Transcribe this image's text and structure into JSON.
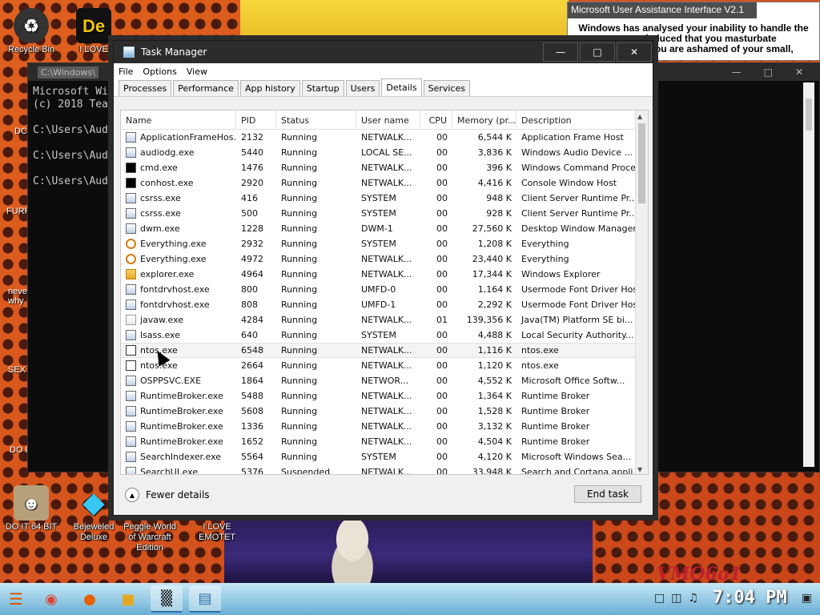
{
  "desktop": {
    "icons": [
      {
        "label": "Recycle Bin"
      },
      {
        "label": "I LOVE"
      },
      {
        "label": "DO IT 64 BIT"
      },
      {
        "label": "Bejeweled Deluxe"
      },
      {
        "label": "Peggle World of Warcraft Edition"
      },
      {
        "label": "I LOVE EMOTET"
      }
    ],
    "edge_labels": [
      "DC",
      "FURF",
      "neve why",
      "SEX",
      "DO I",
      "DO I"
    ],
    "bottom_art_text": "VMO6o1"
  },
  "console": {
    "title": "C:\\Windows\\",
    "lines": [
      "Microsoft Wi",
      "(c) 2018 Tea",
      "",
      "C:\\Users\\Audi",
      "",
      "C:\\Users\\Audi",
      "",
      "C:\\Users\\Audi"
    ]
  },
  "assist": {
    "title": "Microsoft User Assistance Interface V2.1",
    "lines": [
      "Windows has analysed your inability to handle the",
      "deduced that you masturbate",
      "e you are ashamed of your small,"
    ]
  },
  "task_manager": {
    "title": "Task Manager",
    "menu": [
      "File",
      "Options",
      "View"
    ],
    "tabs": [
      "Processes",
      "Performance",
      "App history",
      "Startup",
      "Users",
      "Details",
      "Services"
    ],
    "active_tab": "Details",
    "columns": [
      "Name",
      "PID",
      "Status",
      "User name",
      "CPU",
      "Memory (pr...",
      "Description"
    ],
    "rows": [
      {
        "icon": "app",
        "name": "ApplicationFrameHos...",
        "pid": "2132",
        "status": "Running",
        "user": "NETWALK...",
        "cpu": "00",
        "mem": "6,544 K",
        "desc": "Application Frame Host"
      },
      {
        "icon": "app",
        "name": "audiodg.exe",
        "pid": "5440",
        "status": "Running",
        "user": "LOCAL SE...",
        "cpu": "00",
        "mem": "3,836 K",
        "desc": "Windows Audio Device ..."
      },
      {
        "icon": "cmd",
        "name": "cmd.exe",
        "pid": "1476",
        "status": "Running",
        "user": "NETWALK...",
        "cpu": "00",
        "mem": "396 K",
        "desc": "Windows Command Proce..."
      },
      {
        "icon": "cmd",
        "name": "conhost.exe",
        "pid": "2920",
        "status": "Running",
        "user": "NETWALK...",
        "cpu": "00",
        "mem": "4,416 K",
        "desc": "Console Window Host"
      },
      {
        "icon": "app",
        "name": "csrss.exe",
        "pid": "416",
        "status": "Running",
        "user": "SYSTEM",
        "cpu": "00",
        "mem": "948 K",
        "desc": "Client Server Runtime Pr..."
      },
      {
        "icon": "app",
        "name": "csrss.exe",
        "pid": "500",
        "status": "Running",
        "user": "SYSTEM",
        "cpu": "00",
        "mem": "928 K",
        "desc": "Client Server Runtime Pr..."
      },
      {
        "icon": "app",
        "name": "dwm.exe",
        "pid": "1228",
        "status": "Running",
        "user": "DWM-1",
        "cpu": "00",
        "mem": "27,560 K",
        "desc": "Desktop Window Manager"
      },
      {
        "icon": "search",
        "name": "Everything.exe",
        "pid": "2932",
        "status": "Running",
        "user": "SYSTEM",
        "cpu": "00",
        "mem": "1,208 K",
        "desc": "Everything"
      },
      {
        "icon": "search",
        "name": "Everything.exe",
        "pid": "4972",
        "status": "Running",
        "user": "NETWALK...",
        "cpu": "00",
        "mem": "23,440 K",
        "desc": "Everything"
      },
      {
        "icon": "folder",
        "name": "explorer.exe",
        "pid": "4964",
        "status": "Running",
        "user": "NETWALK...",
        "cpu": "00",
        "mem": "17,344 K",
        "desc": "Windows Explorer"
      },
      {
        "icon": "app",
        "name": "fontdrvhost.exe",
        "pid": "800",
        "status": "Running",
        "user": "UMFD-0",
        "cpu": "00",
        "mem": "1,164 K",
        "desc": "Usermode Font Driver Host"
      },
      {
        "icon": "app",
        "name": "fontdrvhost.exe",
        "pid": "808",
        "status": "Running",
        "user": "UMFD-1",
        "cpu": "00",
        "mem": "2,292 K",
        "desc": "Usermode Font Driver Host"
      },
      {
        "icon": "java",
        "name": "javaw.exe",
        "pid": "4284",
        "status": "Running",
        "user": "NETWALK...",
        "cpu": "01",
        "mem": "139,356 K",
        "desc": "Java(TM) Platform SE bi..."
      },
      {
        "icon": "app",
        "name": "lsass.exe",
        "pid": "640",
        "status": "Running",
        "user": "SYSTEM",
        "cpu": "00",
        "mem": "4,488 K",
        "desc": "Local Security Authority..."
      },
      {
        "icon": "file",
        "name": "ntos.exe",
        "pid": "6548",
        "status": "Running",
        "user": "NETWALK...",
        "cpu": "00",
        "mem": "1,116 K",
        "desc": "ntos.exe",
        "selected": true
      },
      {
        "icon": "file",
        "name": "ntos.exe",
        "pid": "2664",
        "status": "Running",
        "user": "NETWALK...",
        "cpu": "00",
        "mem": "1,120 K",
        "desc": "ntos.exe"
      },
      {
        "icon": "app",
        "name": "OSPPSVC.EXE",
        "pid": "1864",
        "status": "Running",
        "user": "NETWOR...",
        "cpu": "00",
        "mem": "4,552 K",
        "desc": "Microsoft Office Softw..."
      },
      {
        "icon": "app",
        "name": "RuntimeBroker.exe",
        "pid": "5488",
        "status": "Running",
        "user": "NETWALK...",
        "cpu": "00",
        "mem": "1,364 K",
        "desc": "Runtime Broker"
      },
      {
        "icon": "app",
        "name": "RuntimeBroker.exe",
        "pid": "5608",
        "status": "Running",
        "user": "NETWALK...",
        "cpu": "00",
        "mem": "1,528 K",
        "desc": "Runtime Broker"
      },
      {
        "icon": "app",
        "name": "RuntimeBroker.exe",
        "pid": "1336",
        "status": "Running",
        "user": "NETWALK...",
        "cpu": "00",
        "mem": "3,132 K",
        "desc": "Runtime Broker"
      },
      {
        "icon": "app",
        "name": "RuntimeBroker.exe",
        "pid": "1652",
        "status": "Running",
        "user": "NETWALK...",
        "cpu": "00",
        "mem": "4,504 K",
        "desc": "Runtime Broker"
      },
      {
        "icon": "app",
        "name": "SearchIndexer.exe",
        "pid": "5564",
        "status": "Running",
        "user": "SYSTEM",
        "cpu": "00",
        "mem": "4,120 K",
        "desc": "Microsoft Windows Sea..."
      },
      {
        "icon": "app",
        "name": "SearchUI.exe",
        "pid": "5376",
        "status": "Suspended",
        "user": "NETWALK...",
        "cpu": "00",
        "mem": "33,948 K",
        "desc": "Search and Cortana appli..."
      }
    ],
    "footer": {
      "fewer_details": "Fewer details",
      "end_task": "End task"
    }
  },
  "taskbar": {
    "clock": "7:04 PM"
  }
}
